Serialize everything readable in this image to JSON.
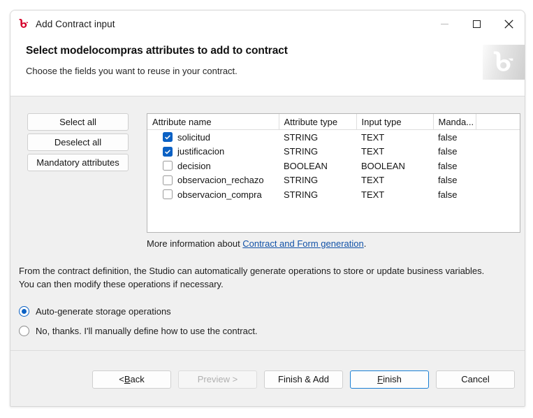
{
  "window": {
    "title": "Add Contract input",
    "app_icon": "bonita-logo-icon",
    "controls": {
      "minimize": "minimize-icon",
      "maximize": "maximize-icon",
      "close": "close-icon"
    }
  },
  "header": {
    "title": "Select modelocompras attributes to add to contract",
    "subtitle": "Choose the fields you want to reuse in your contract.",
    "logo": "bonita-logo-icon"
  },
  "side_buttons": [
    {
      "label": "Select all"
    },
    {
      "label": "Deselect all"
    },
    {
      "label": "Mandatory attributes"
    }
  ],
  "table": {
    "columns": [
      "Attribute name",
      "Attribute type",
      "Input type",
      "Manda...",
      ""
    ],
    "rows": [
      {
        "checked": true,
        "name": "solicitud",
        "attribute_type": "STRING",
        "input_type": "TEXT",
        "mandatory": "false"
      },
      {
        "checked": true,
        "name": "justificacion",
        "attribute_type": "STRING",
        "input_type": "TEXT",
        "mandatory": "false"
      },
      {
        "checked": false,
        "name": "decision",
        "attribute_type": "BOOLEAN",
        "input_type": "BOOLEAN",
        "mandatory": "false"
      },
      {
        "checked": false,
        "name": "observacion_rechazo",
        "attribute_type": "STRING",
        "input_type": "TEXT",
        "mandatory": "false"
      },
      {
        "checked": false,
        "name": "observacion_compra",
        "attribute_type": "STRING",
        "input_type": "TEXT",
        "mandatory": "false"
      }
    ]
  },
  "more_info": {
    "prefix": "More information about ",
    "link": "Contract and Form generation",
    "suffix": "."
  },
  "description": {
    "line1": "From the contract definition, the Studio can automatically generate operations to store or update business variables.",
    "line2": "You can then modify these operations if necessary."
  },
  "radios": [
    {
      "label": "Auto-generate storage operations",
      "selected": true
    },
    {
      "label": "No, thanks. I'll manually define how to use the contract.",
      "selected": false
    }
  ],
  "footer_buttons": [
    {
      "label_pre": "< ",
      "mnemonic": "B",
      "label_post": "ack",
      "state": "normal"
    },
    {
      "label_pre": "Preview >",
      "mnemonic": "",
      "label_post": "",
      "state": "disabled"
    },
    {
      "label_pre": "Finish & Add",
      "mnemonic": "",
      "label_post": "",
      "state": "normal"
    },
    {
      "label_pre": "",
      "mnemonic": "F",
      "label_post": "inish",
      "state": "focused"
    },
    {
      "label_pre": "Cancel",
      "mnemonic": "",
      "label_post": "",
      "state": "normal"
    }
  ],
  "colors": {
    "accent_blue": "#0b61c4",
    "link_blue": "#1252a8",
    "brand_red": "#d6002b",
    "body_bg": "#f0f0f0"
  }
}
